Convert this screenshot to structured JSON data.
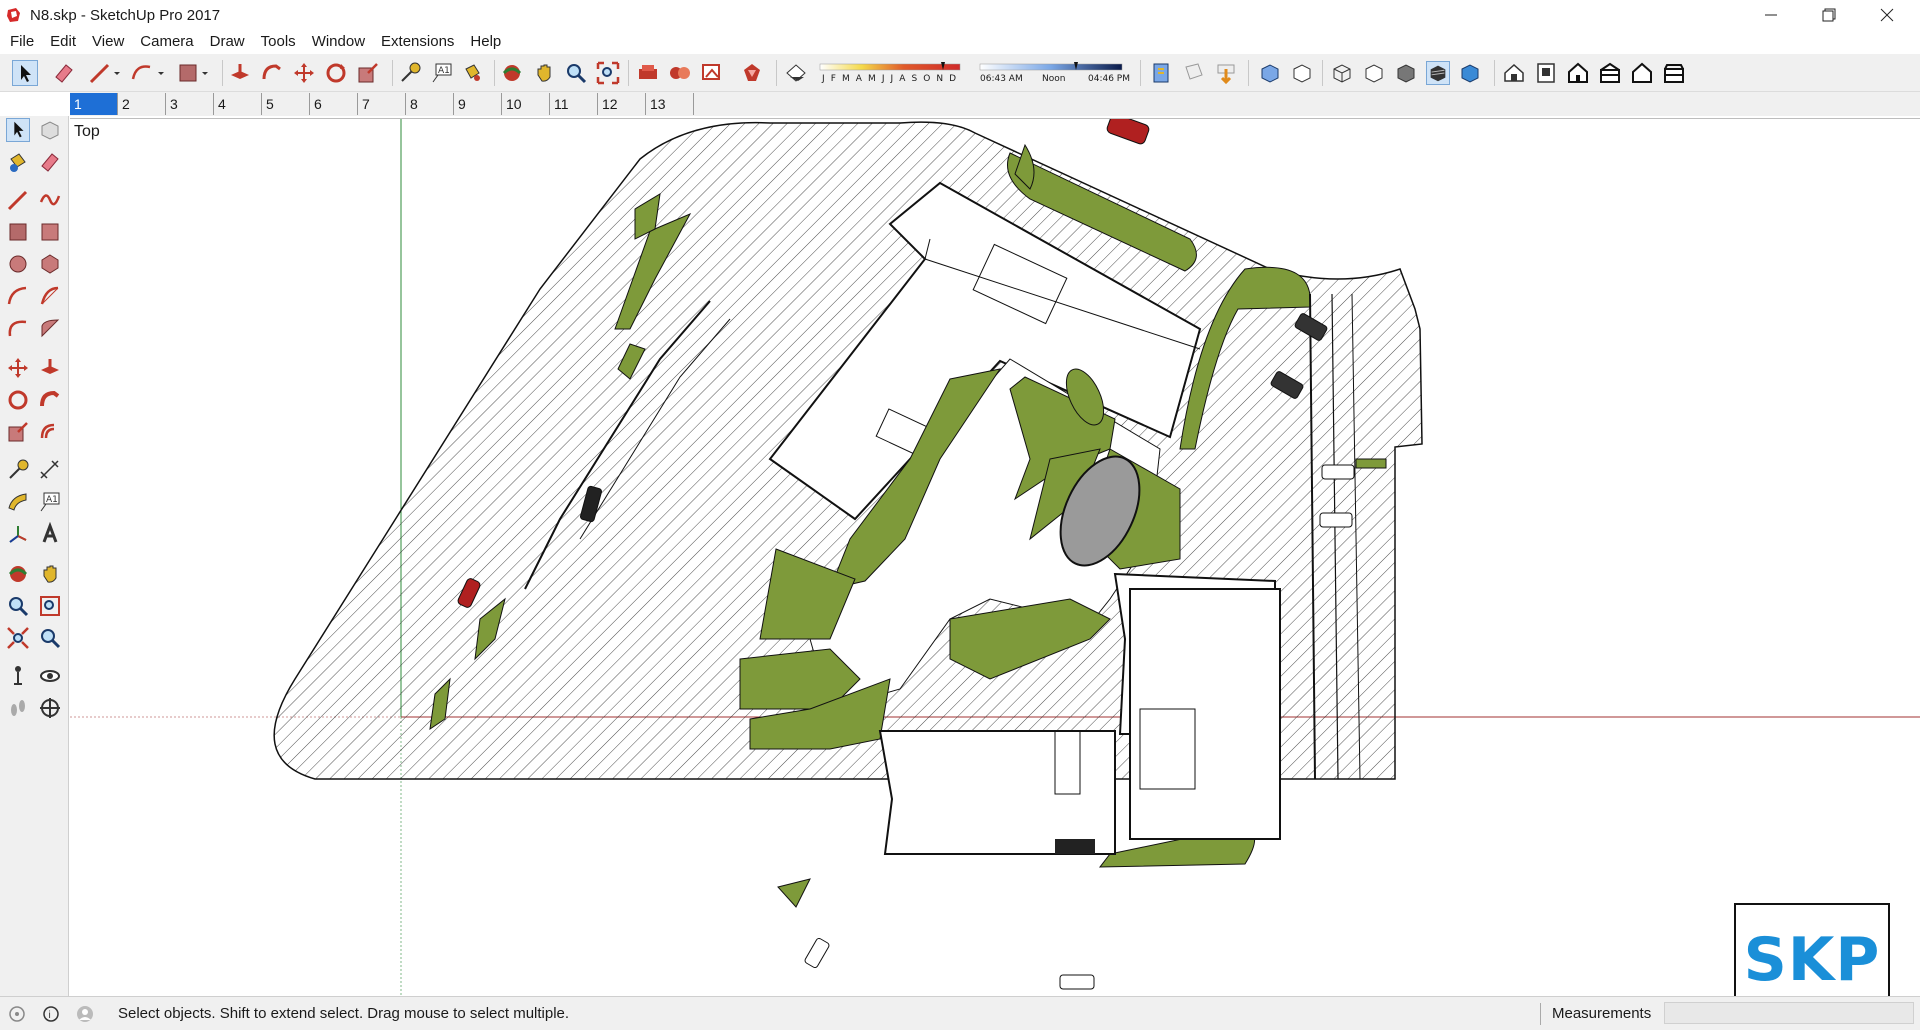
{
  "window": {
    "title": "N8.skp - SketchUp Pro 2017"
  },
  "menu": [
    "File",
    "Edit",
    "View",
    "Camera",
    "Draw",
    "Tools",
    "Window",
    "Extensions",
    "Help"
  ],
  "shadow": {
    "months": "J F M A M J J A S O N D",
    "time_start": "06:43 AM",
    "time_mid": "Noon",
    "time_end": "04:46 PM"
  },
  "scenes": [
    "1",
    "2",
    "3",
    "4",
    "5",
    "6",
    "7",
    "8",
    "9",
    "10",
    "11",
    "12",
    "13"
  ],
  "active_scene_index": 0,
  "viewport": {
    "view_name": "Top",
    "watermark": "SKP"
  },
  "status": {
    "message": "Select objects. Shift to extend select. Drag mouse to select multiple.",
    "measurements_label": "Measurements",
    "measurements_value": ""
  },
  "colors": {
    "grass": "#7e9a3a",
    "accent": "#1e6fd6",
    "skp_blue": "#1a8fd8",
    "tool_red": "#c0392b"
  }
}
